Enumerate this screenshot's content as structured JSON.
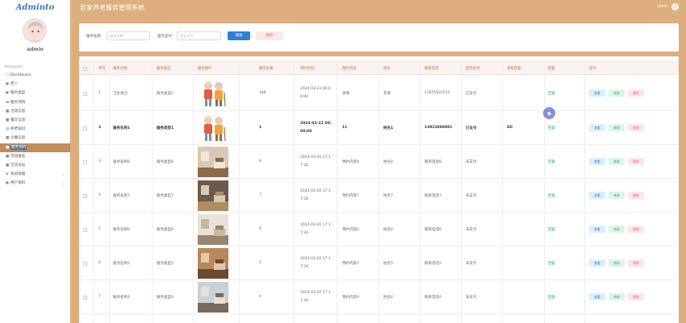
{
  "app": {
    "logo": "Adminto",
    "title": "居家养老服务管理系统",
    "user": "admin"
  },
  "sidebar": {
    "user": "admin",
    "nav_label": "Navigation",
    "items": [
      {
        "label": "Dashboard",
        "icon": "circle-icon",
        "active": false,
        "chevron": false
      },
      {
        "label": "老人",
        "icon": "user-icon",
        "active": false,
        "chevron": false
      },
      {
        "label": "服务类型",
        "icon": "user-icon",
        "active": false,
        "chevron": false
      },
      {
        "label": "服务项目",
        "icon": "card-icon",
        "active": false,
        "chevron": false
      },
      {
        "label": "活动信息",
        "icon": "list-icon",
        "active": false,
        "chevron": false
      },
      {
        "label": "餐饮信息",
        "icon": "list-icon",
        "active": false,
        "chevron": false
      },
      {
        "label": "养老知识",
        "icon": "book-icon",
        "active": false,
        "chevron": false
      },
      {
        "label": "诊餐信息",
        "icon": "list-icon",
        "active": false,
        "chevron": false
      },
      {
        "label": "服务预约",
        "icon": "list-icon",
        "active": true,
        "chevron": false
      },
      {
        "label": "活动报名",
        "icon": "list-icon",
        "active": false,
        "chevron": false
      },
      {
        "label": "交流论坛",
        "icon": "list-icon",
        "active": false,
        "chevron": false
      },
      {
        "label": "系统管理",
        "icon": "gear-icon",
        "active": false,
        "chevron": true
      },
      {
        "label": "用户资料",
        "icon": "user-icon",
        "active": false,
        "chevron": true
      }
    ]
  },
  "filter": {
    "name_label": "服务名称",
    "name_placeholder": "服务名称",
    "pay_label": "是否支付",
    "pay_placeholder": "是否支付",
    "search_label": "搜索",
    "delete_label": "删除"
  },
  "table": {
    "columns": [
      "",
      "序号",
      "服务名称",
      "服务类型",
      "服务图片",
      "服务价格",
      "预约时间",
      "预约内容",
      "姓名",
      "联系电话",
      "是否支付",
      "审核回复",
      "回复",
      "操作"
    ],
    "actions": {
      "view": "查看",
      "edit": "修改",
      "delete": "删除"
    },
    "rows": [
      {
        "no": "1",
        "name": "卫生清洁",
        "type": "服务类型2",
        "img": "elder",
        "price": "188",
        "time1": "2024-03-23 00:0",
        "time2": "0:00",
        "content": "测测",
        "person": "老黄",
        "phone": "13655622531",
        "paid": "已支付",
        "review": "",
        "reply": "回复",
        "bold": false
      },
      {
        "no": "2",
        "name": "服务名称1",
        "type": "服务类型1",
        "img": "elder",
        "price": "1",
        "time1": "2024-03-22 00:",
        "time2": "00:00",
        "content": "11",
        "person": "姓名1",
        "phone": "13823888881",
        "paid": "已支付",
        "review": "SD",
        "reply": "回复",
        "bold": true
      },
      {
        "no": "3",
        "name": "服务名称8",
        "type": "服务类型8",
        "img": "room1",
        "price": "8",
        "time1": "2024-03-20 17:1",
        "time2": "7:26",
        "content": "预约内容8",
        "person": "姓名8",
        "phone": "联系电话8",
        "paid": "未支付",
        "review": "",
        "reply": "回复",
        "bold": false
      },
      {
        "no": "4",
        "name": "服务名称7",
        "type": "服务类型7",
        "img": "room2",
        "price": "7",
        "time1": "2024-03-20 17:1",
        "time2": "7:26",
        "content": "预约内容7",
        "person": "姓名7",
        "phone": "联系电话7",
        "paid": "未支付",
        "review": "",
        "reply": "回复",
        "bold": false
      },
      {
        "no": "5",
        "name": "服务名称6",
        "type": "服务类型6",
        "img": "room3",
        "price": "6",
        "time1": "2024-03-20 17:1",
        "time2": "7:26",
        "content": "预约内容6",
        "person": "姓名6",
        "phone": "联系电话6",
        "paid": "未支付",
        "review": "",
        "reply": "回复",
        "bold": false
      },
      {
        "no": "6",
        "name": "服务名称5",
        "type": "服务类型5",
        "img": "room4",
        "price": "5",
        "time1": "2024-03-20 17:1",
        "time2": "7:26",
        "content": "预约内容5",
        "person": "姓名5",
        "phone": "联系电话5",
        "paid": "未支付",
        "review": "",
        "reply": "回复",
        "bold": false
      },
      {
        "no": "7",
        "name": "服务名称4",
        "type": "服务类型4",
        "img": "room5",
        "price": "4",
        "time1": "2024-03-20 17:1",
        "time2": "7:26",
        "content": "预约内容4",
        "person": "姓名4",
        "phone": "联系电话4",
        "paid": "未支付",
        "review": "",
        "reply": "回复",
        "bold": false
      }
    ]
  },
  "colors": {
    "page_bg": "#dcae80",
    "active_nav": "#c58b5a",
    "header_text": "#d0683c",
    "primary": "#2f7fd8",
    "success": "#2aa570",
    "danger": "#e66666"
  }
}
